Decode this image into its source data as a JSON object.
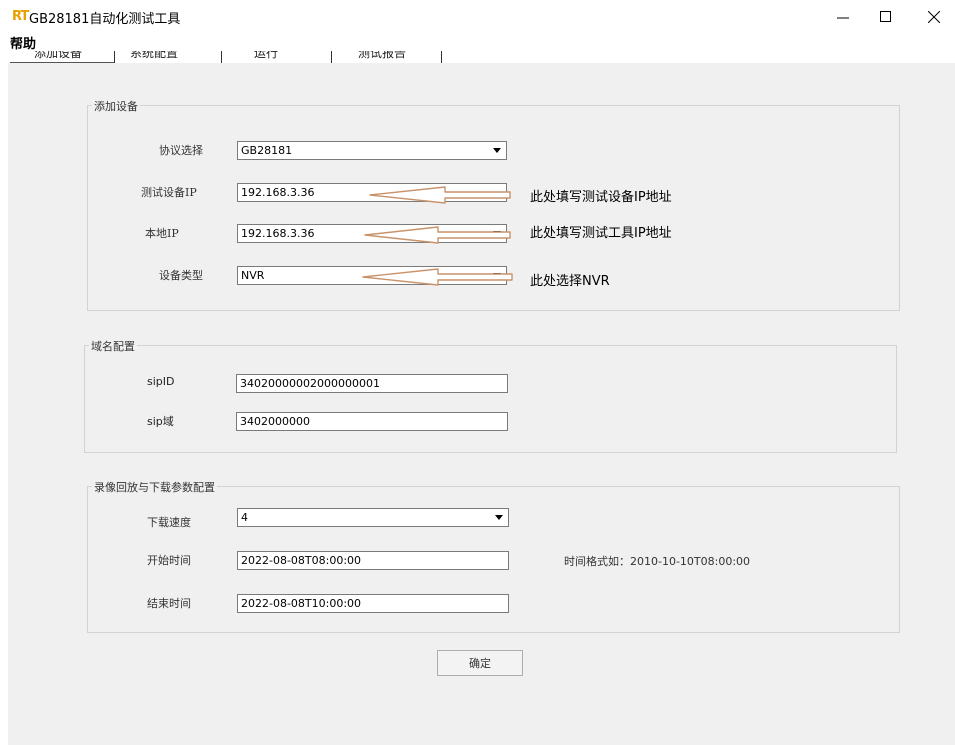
{
  "window": {
    "logo_text": "RT",
    "title": "GB28181自动化测试工具",
    "minimize_label": "—",
    "maximize_label": "□",
    "close_label": "×"
  },
  "menu": {
    "help": "帮助"
  },
  "tabs": [
    "添加设备",
    "系统配置",
    "运行",
    "测试报告"
  ],
  "add_device": {
    "legend": "添加设备",
    "protocol": {
      "label": "协议选择",
      "value": "GB28181"
    },
    "device_ip": {
      "label": "测试设备IP",
      "value": "192.168.3.36",
      "note": "此处填写测试设备IP地址"
    },
    "local_ip": {
      "label": "本地IP",
      "value": "192.168.3.36",
      "note": "此处填写测试工具IP地址"
    },
    "device_type": {
      "label": "设备类型",
      "value": "NVR",
      "note": "此处选择NVR"
    }
  },
  "domain": {
    "legend": "域名配置",
    "sip_id": {
      "label": "sipID",
      "value": "34020000002000000001"
    },
    "sip_domain": {
      "label": "sip域",
      "value": "3402000000"
    }
  },
  "playback": {
    "legend": "录像回放与下载参数配置",
    "speed": {
      "label": "下载速度",
      "value": "4"
    },
    "start_time": {
      "label": "开始时间",
      "value": "2022-08-08T08:00:00"
    },
    "end_time": {
      "label": "结束时间",
      "value": "2022-08-08T10:00:00"
    },
    "format_hint": "时间格式如：2010-10-10T08:00:00"
  },
  "ok_button": "确定",
  "colors": {
    "annotation_arrow": "#c8936a",
    "logo": "#e8a000"
  }
}
